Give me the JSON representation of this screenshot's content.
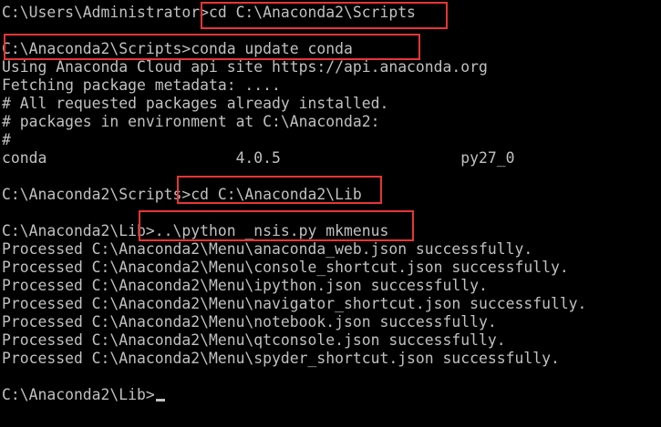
{
  "terminal": {
    "lines": [
      "C:\\Users\\Administrator>cd C:\\Anaconda2\\Scripts",
      "",
      "C:\\Anaconda2\\Scripts>conda update conda",
      "Using Anaconda Cloud api site https://api.anaconda.org",
      "Fetching package metadata: ....",
      "# All requested packages already installed.",
      "# packages in environment at C:\\Anaconda2:",
      "#",
      "conda                     4.0.5                    py27_0",
      "",
      "C:\\Anaconda2\\Scripts>cd C:\\Anaconda2\\Lib",
      "",
      "C:\\Anaconda2\\Lib>..\\python _nsis.py mkmenus",
      "Processed C:\\Anaconda2\\Menu\\anaconda_web.json successfully.",
      "Processed C:\\Anaconda2\\Menu\\console_shortcut.json successfully.",
      "Processed C:\\Anaconda2\\Menu\\ipython.json successfully.",
      "Processed C:\\Anaconda2\\Menu\\navigator_shortcut.json successfully.",
      "Processed C:\\Anaconda2\\Menu\\notebook.json successfully.",
      "Processed C:\\Anaconda2\\Menu\\qtconsole.json successfully.",
      "Processed C:\\Anaconda2\\Menu\\spyder_shortcut.json successfully.",
      "",
      "C:\\Anaconda2\\Lib>"
    ]
  },
  "colors": {
    "background": "#000000",
    "text": "#c0c0c0",
    "highlight_box": "#e83535"
  }
}
